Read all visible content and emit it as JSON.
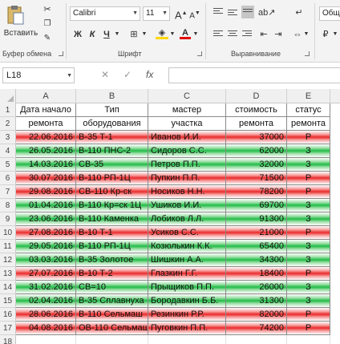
{
  "ribbon": {
    "paste_label": "Вставить",
    "font_name": "Calibri",
    "font_size": "11",
    "grow_font": "A",
    "shrink_font": "A",
    "bold": "Ж",
    "italic": "К",
    "underline": "Ч",
    "font_color_glyph": "A",
    "style_box": "Общ",
    "groups": {
      "clipboard": "Буфер обмена",
      "font": "Шрифт",
      "alignment": "Выравнивание"
    }
  },
  "formula_bar": {
    "name_box": "L18",
    "fx": "fx",
    "formula": ""
  },
  "grid": {
    "columns": [
      "A",
      "B",
      "C",
      "D",
      "E"
    ],
    "headers": {
      "r1": [
        "Дата начало",
        "Тип",
        "мастер",
        "стоимость",
        "статус"
      ],
      "r2": [
        "ремонта",
        "оборудования",
        "участка",
        "ремонта",
        "ремонта"
      ]
    },
    "rows": [
      {
        "n": "3",
        "date": "22.06.2016",
        "type": "В-35 Т-1",
        "master": "Иванов И.И.",
        "cost": "37000",
        "status": "Р",
        "color": "red"
      },
      {
        "n": "4",
        "date": "26.05.2016",
        "type": "В-110 ПНС-2",
        "master": "Сидоров С.С.",
        "cost": "62000",
        "status": "З",
        "color": "green"
      },
      {
        "n": "5",
        "date": "14.03.2016",
        "type": "СВ-35",
        "master": "Петров П.П.",
        "cost": "32000",
        "status": "З",
        "color": "green"
      },
      {
        "n": "6",
        "date": "30.07.2016",
        "type": "В-110 РП-1Ц",
        "master": "Пупкин П.П.",
        "cost": "71500",
        "status": "Р",
        "color": "red"
      },
      {
        "n": "7",
        "date": "29.08.2016",
        "type": "СВ-110 Кр-ск",
        "master": "Носиков Н.Н.",
        "cost": "78200",
        "status": "Р",
        "color": "red"
      },
      {
        "n": "8",
        "date": "01.04.2016",
        "type": "В-110 Кр=ск 1Ц",
        "master": "Ушиков И.И.",
        "cost": "69700",
        "status": "З",
        "color": "green"
      },
      {
        "n": "9",
        "date": "23.06.2016",
        "type": "В-110 Каменка",
        "master": "Лобиков Л.Л.",
        "cost": "91300",
        "status": "З",
        "color": "green"
      },
      {
        "n": "10",
        "date": "27.08.2016",
        "type": "В-10 Т-1",
        "master": "Усиков С.С.",
        "cost": "21000",
        "status": "Р",
        "color": "red"
      },
      {
        "n": "11",
        "date": "29.05.2016",
        "type": "В-110 РП-1Ц",
        "master": "Козюлькин К.К.",
        "cost": "65400",
        "status": "З",
        "color": "green"
      },
      {
        "n": "12",
        "date": "03.03.2016",
        "type": "В-35 Золотое",
        "master": "Шишкин А.А.",
        "cost": "34300",
        "status": "З",
        "color": "green"
      },
      {
        "n": "13",
        "date": "27.07.2016",
        "type": "В-10 Т-2",
        "master": "Глазкин Г.Г.",
        "cost": "18400",
        "status": "Р",
        "color": "red"
      },
      {
        "n": "14",
        "date": "31.02.2016",
        "type": "СВ=10",
        "master": "Прыщиков П.П.",
        "cost": "26000",
        "status": "З",
        "color": "green"
      },
      {
        "n": "15",
        "date": "02.04.2016",
        "type": "В-35 Сплавнуха",
        "master": "Бородавкин Б.Б.",
        "cost": "31300",
        "status": "З",
        "color": "green"
      },
      {
        "n": "16",
        "date": "28.06.2016",
        "type": "В-110 Сельмаш",
        "master": "Резинкин Р.Р.",
        "cost": "82000",
        "status": "Р",
        "color": "red"
      },
      {
        "n": "17",
        "date": "04.08.2016",
        "type": "ОВ-110 Сельмаш",
        "master": "Пуговкин П.П.",
        "cost": "74200",
        "status": "Р",
        "color": "red"
      }
    ],
    "row_numbers_empty": [
      "18"
    ],
    "header_row_numbers": [
      "1",
      "2"
    ],
    "colors": {
      "red": "#ea2a2a",
      "green": "#21bd47"
    }
  }
}
